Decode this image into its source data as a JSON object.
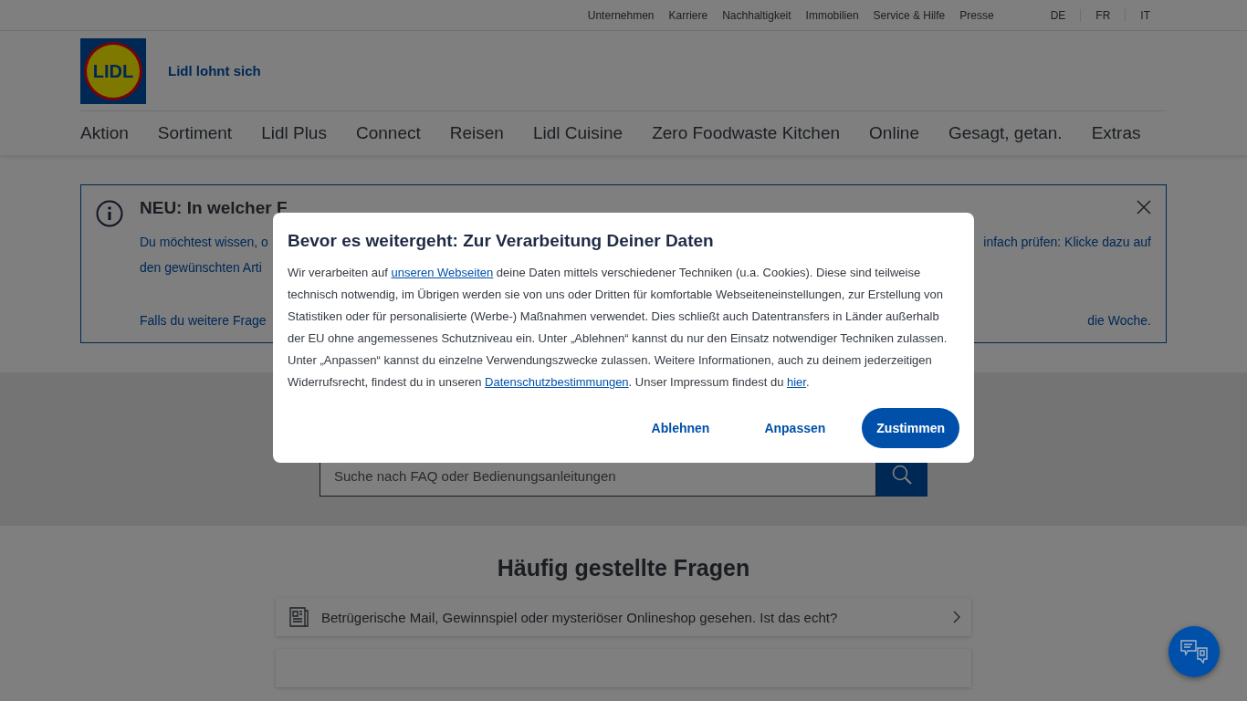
{
  "top_links": [
    "Unternehmen",
    "Karriere",
    "Nachhaltigkeit",
    "Immobilien",
    "Service & Hilfe",
    "Presse"
  ],
  "languages": [
    "DE",
    "FR",
    "IT"
  ],
  "logo": {
    "text": "LIDL"
  },
  "tagline": "Lidl lohnt sich",
  "nav": [
    "Aktion",
    "Sortiment",
    "Lidl Plus",
    "Connect",
    "Reisen",
    "Lidl Cuisine",
    "Zero Foodwaste Kitchen",
    "Online",
    "Gesagt, getan.",
    "Extras"
  ],
  "notice": {
    "title": "NEU: In welcher F",
    "rows": [
      {
        "left": "Du möchtest wissen, o",
        "right": "infach prüfen: Klicke dazu auf"
      },
      {
        "left": "den gewünschten Arti",
        "right": ""
      },
      {
        "left": "Falls du weitere Frage",
        "right": "die Woche."
      }
    ]
  },
  "search": {
    "placeholder": "Suche nach FAQ oder Bedienungsanleitungen"
  },
  "faq": {
    "heading": "Häufig gestellte Fragen",
    "items": [
      "Betrügerische Mail, Gewinnspiel oder mysteriöser Onlineshop gesehen. Ist das echt?"
    ]
  },
  "consent": {
    "title": "Bevor es weitergeht: Zur Verarbeitung Deiner Daten",
    "body": [
      {
        "kind": "text",
        "text": "Wir verarbeiten auf "
      },
      {
        "kind": "link",
        "text": "unseren Webseiten"
      },
      {
        "kind": "text",
        "text": " deine Daten mittels verschiedener Techniken (u.a. Cookies). Diese sind teilweise technisch notwendig, im Übrigen werden sie von uns oder Dritten für komfortable Webseiteneinstellungen, zur Erstellung von Statistiken oder für personalisierte (Werbe-) Maßnahmen verwendet. Dies schließt auch Datentransfers in Länder außerhalb der EU ohne angemessenes Schutzniveau ein. Unter „Ablehnen“ kannst du nur den Einsatz notwendiger Techniken zulassen. Unter „Anpassen“ kannst du einzelne Verwendungszwecke zulassen. Weitere Informationen, auch zu deinem jederzeitigen Widerrufsrecht, findest du in unseren "
      },
      {
        "kind": "link",
        "text": "Datenschutzbestimmungen"
      },
      {
        "kind": "text",
        "text": ". Unser Impressum findest du "
      },
      {
        "kind": "link",
        "text": "hier"
      },
      {
        "kind": "text",
        "text": "."
      }
    ],
    "buttons": [
      {
        "label": "Ablehnen",
        "kind": "text"
      },
      {
        "label": "Anpassen",
        "kind": "text"
      },
      {
        "label": "Zustimmen",
        "kind": "primary"
      }
    ]
  }
}
